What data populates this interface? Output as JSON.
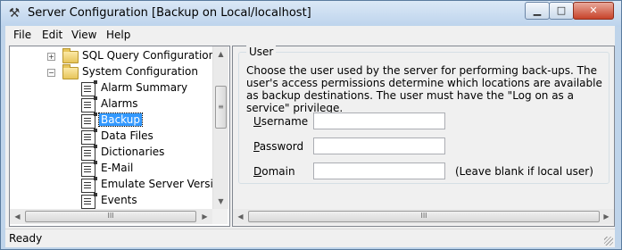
{
  "window": {
    "title": "Server Configuration [Backup on Local/localhost]",
    "app_icon": "tools-icon",
    "controls": {
      "minimize": "▁",
      "maximize": "□",
      "close": "✕"
    }
  },
  "menu": {
    "items": [
      {
        "label": "File"
      },
      {
        "label": "Edit"
      },
      {
        "label": "View"
      },
      {
        "label": "Help"
      }
    ]
  },
  "tree": {
    "folders": [
      {
        "label": "SQL Query Configuration",
        "expander": "+"
      },
      {
        "label": "System Configuration",
        "expander": "−"
      }
    ],
    "items": [
      {
        "label": "Alarm Summary"
      },
      {
        "label": "Alarms"
      },
      {
        "label": "Backup",
        "selected": true
      },
      {
        "label": "Data Files"
      },
      {
        "label": "Dictionaries"
      },
      {
        "label": "E-Mail"
      },
      {
        "label": "Emulate Server Version"
      },
      {
        "label": "Events"
      }
    ],
    "scroll_glyphs": {
      "up": "▲",
      "down": "▼",
      "left": "◀",
      "right": "▶",
      "grip_v": "≡",
      "grip_h": "III"
    }
  },
  "panel": {
    "group_title": "User",
    "description": "Choose the user used by the server for performing back-ups. The user's access permissions determine which locations are available as backup destinations. The user must have the \"Log on as a service\" privilege.",
    "fields": {
      "username": {
        "label_key": "U",
        "label_rest": "sername",
        "value": ""
      },
      "password": {
        "label_key": "P",
        "label_rest": "assword",
        "value": ""
      },
      "domain": {
        "label_key": "D",
        "label_rest": "omain",
        "value": ""
      }
    },
    "domain_hint": "(Leave blank if local user)"
  },
  "status": {
    "text": "Ready"
  },
  "colors": {
    "selection": "#3399ff",
    "title_bg": "#bcd3ec",
    "close_button": "#c7432a"
  }
}
